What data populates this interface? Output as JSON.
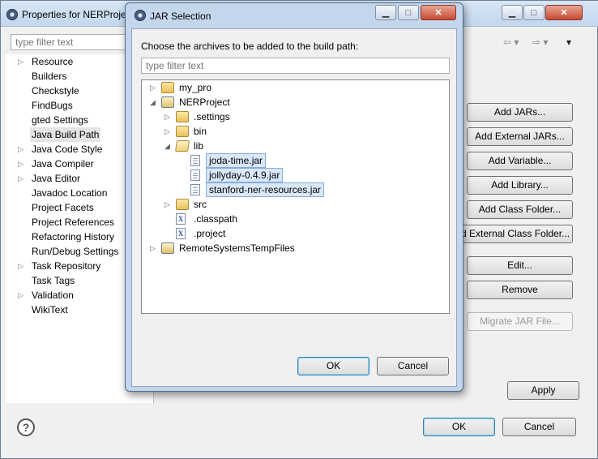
{
  "props_window": {
    "title": "Properties for NERProject",
    "filter_placeholder": "type filter text",
    "nav_items": [
      {
        "label": "Resource",
        "expandable": true
      },
      {
        "label": "Builders",
        "expandable": false
      },
      {
        "label": "Checkstyle",
        "expandable": false
      },
      {
        "label": "FindBugs",
        "expandable": false
      },
      {
        "label": "gted Settings",
        "expandable": false
      },
      {
        "label": "Java Build Path",
        "expandable": false,
        "selected": true
      },
      {
        "label": "Java Code Style",
        "expandable": true
      },
      {
        "label": "Java Compiler",
        "expandable": true
      },
      {
        "label": "Java Editor",
        "expandable": true
      },
      {
        "label": "Javadoc Location",
        "expandable": false
      },
      {
        "label": "Project Facets",
        "expandable": false
      },
      {
        "label": "Project References",
        "expandable": false
      },
      {
        "label": "Refactoring History",
        "expandable": false
      },
      {
        "label": "Run/Debug Settings",
        "expandable": false
      },
      {
        "label": "Task Repository",
        "expandable": true
      },
      {
        "label": "Task Tags",
        "expandable": false
      },
      {
        "label": "Validation",
        "expandable": true
      },
      {
        "label": "WikiText",
        "expandable": false
      }
    ],
    "right_buttons": {
      "add_jars": "Add JARs...",
      "add_external_jars": "Add External JARs...",
      "add_variable": "Add Variable...",
      "add_library": "Add Library...",
      "add_class_folder": "Add Class Folder...",
      "add_external_class_folder": "d External Class Folder...",
      "edit": "Edit...",
      "remove": "Remove",
      "migrate_jar": "Migrate JAR File..."
    },
    "apply_label": "Apply",
    "ok_label": "OK",
    "cancel_label": "Cancel"
  },
  "jar_dialog": {
    "title": "JAR Selection",
    "message": "Choose the archives to be added to the build path:",
    "filter_placeholder": "type filter text",
    "tree": [
      {
        "label": "my_pro",
        "icon": "folder-icon",
        "expander": "collapsed",
        "depth": 0
      },
      {
        "label": "NERProject",
        "icon": "project-icon",
        "expander": "expanded",
        "depth": 0
      },
      {
        "label": ".settings",
        "icon": "folder-icon",
        "expander": "collapsed",
        "depth": 1
      },
      {
        "label": "bin",
        "icon": "folder-icon",
        "expander": "collapsed",
        "depth": 1
      },
      {
        "label": "lib",
        "icon": "folder-open-icon",
        "expander": "expanded",
        "depth": 1
      },
      {
        "label": "joda-time.jar",
        "icon": "jar-icon",
        "expander": "none",
        "depth": 2,
        "selected": true
      },
      {
        "label": "jollyday-0.4.9.jar",
        "icon": "jar-icon",
        "expander": "none",
        "depth": 2,
        "selected": true
      },
      {
        "label": "stanford-ner-resources.jar",
        "icon": "jar-icon",
        "expander": "none",
        "depth": 2,
        "selected": true
      },
      {
        "label": "src",
        "icon": "folder-icon",
        "expander": "collapsed",
        "depth": 1
      },
      {
        "label": ".classpath",
        "icon": "xml-file-icon",
        "expander": "none",
        "depth": 1
      },
      {
        "label": ".project",
        "icon": "xml-file-icon",
        "expander": "none",
        "depth": 1
      },
      {
        "label": "RemoteSystemsTempFiles",
        "icon": "project-icon",
        "expander": "collapsed",
        "depth": 0
      }
    ],
    "ok_label": "OK",
    "cancel_label": "Cancel"
  },
  "glyphs": {
    "collapsed": "▷",
    "expanded": "◢",
    "minimize": "▁",
    "maximize": "□",
    "close": "✕",
    "help": "?",
    "nav_back": "⇦ ▾",
    "nav_forward": "⇨ ▾",
    "nav_menu": "▾"
  }
}
